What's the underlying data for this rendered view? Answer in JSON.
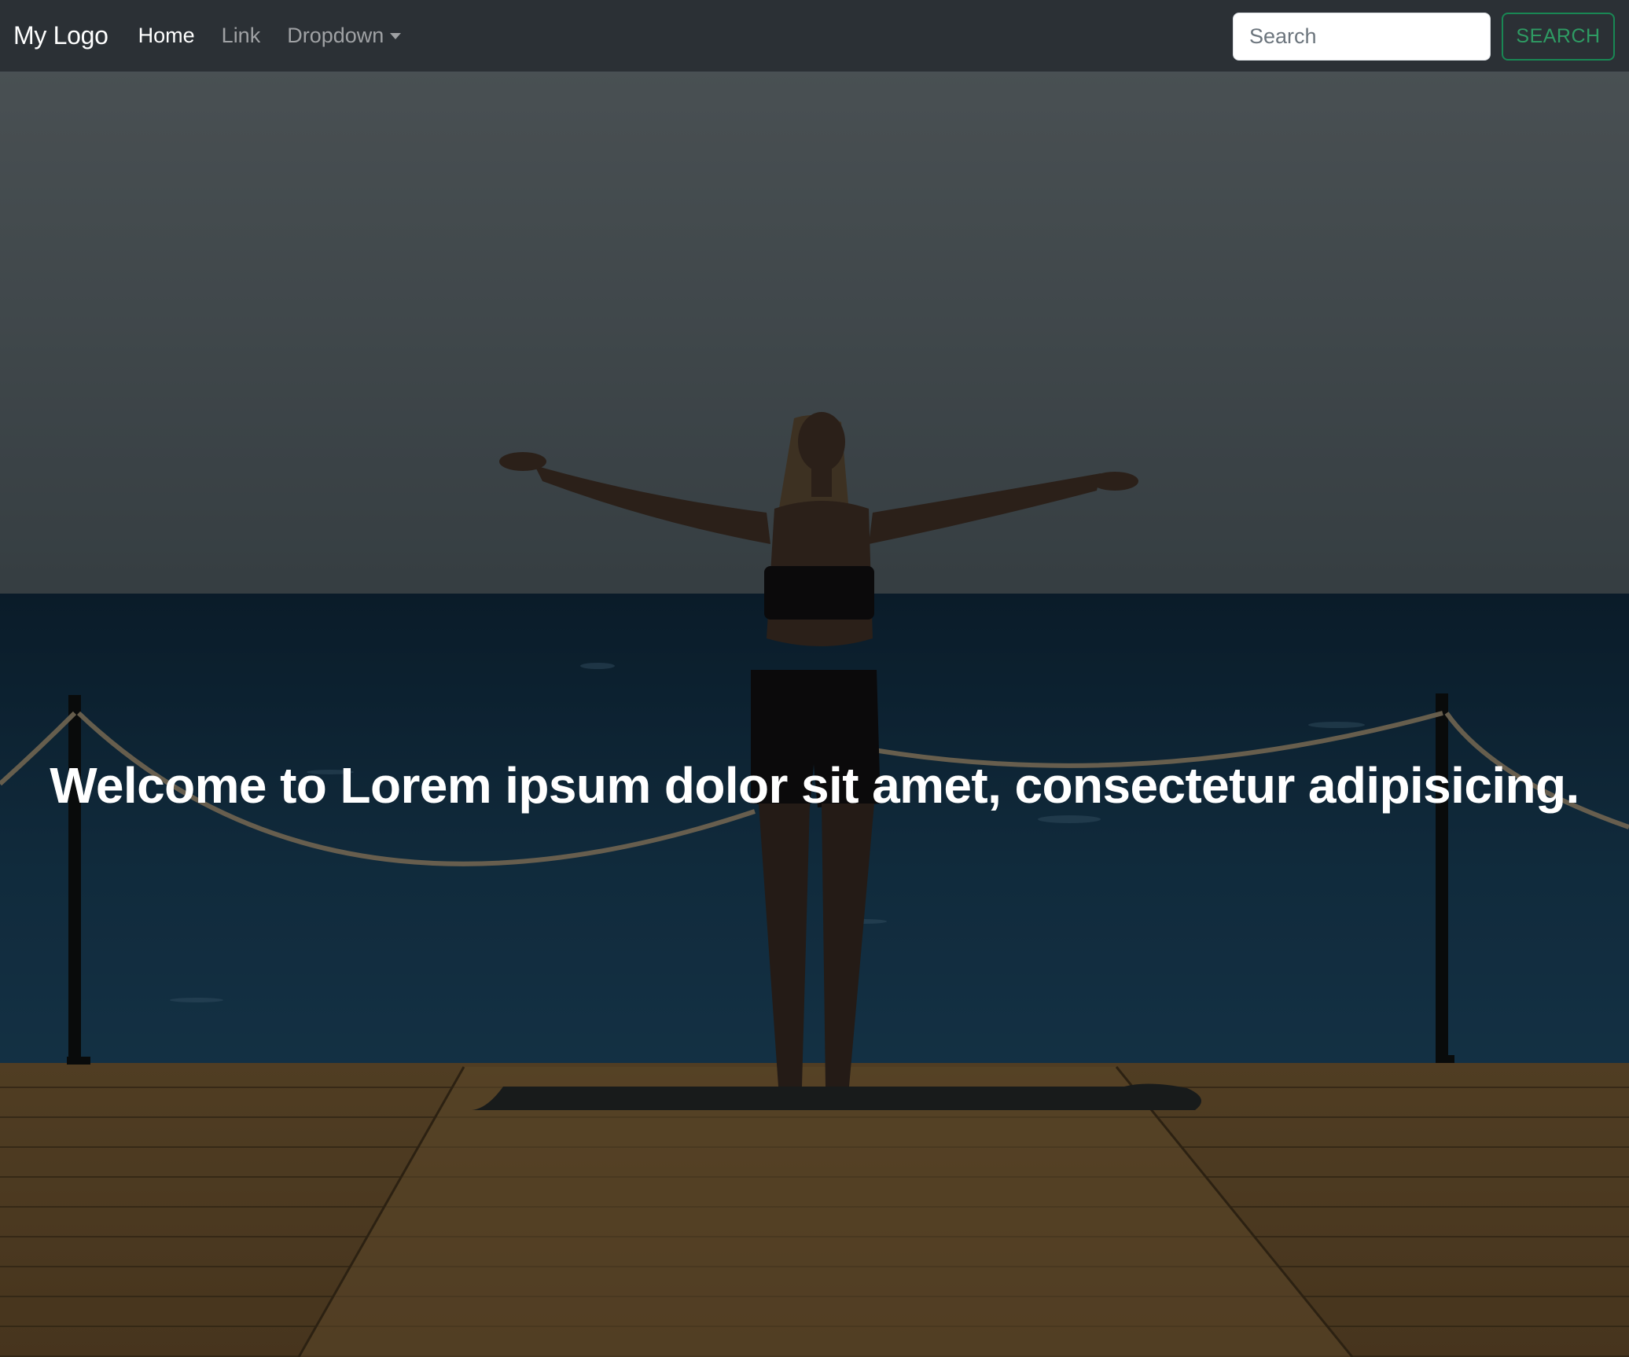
{
  "navbar": {
    "brand": "My Logo",
    "links": [
      {
        "label": "Home",
        "active": true
      },
      {
        "label": "Link",
        "active": false
      },
      {
        "label": "Dropdown",
        "active": false
      }
    ],
    "search": {
      "placeholder": "Search",
      "value": "",
      "button_label": "SEARCH"
    }
  },
  "hero": {
    "title": "Welcome to Lorem ipsum dolor sit amet, consectetur adipisicing."
  },
  "colors": {
    "navbar_bg": "#2b3035",
    "search_accent": "#198754",
    "title_text": "#ffffff"
  },
  "icons": {
    "dropdown": "chevron-down-icon"
  }
}
